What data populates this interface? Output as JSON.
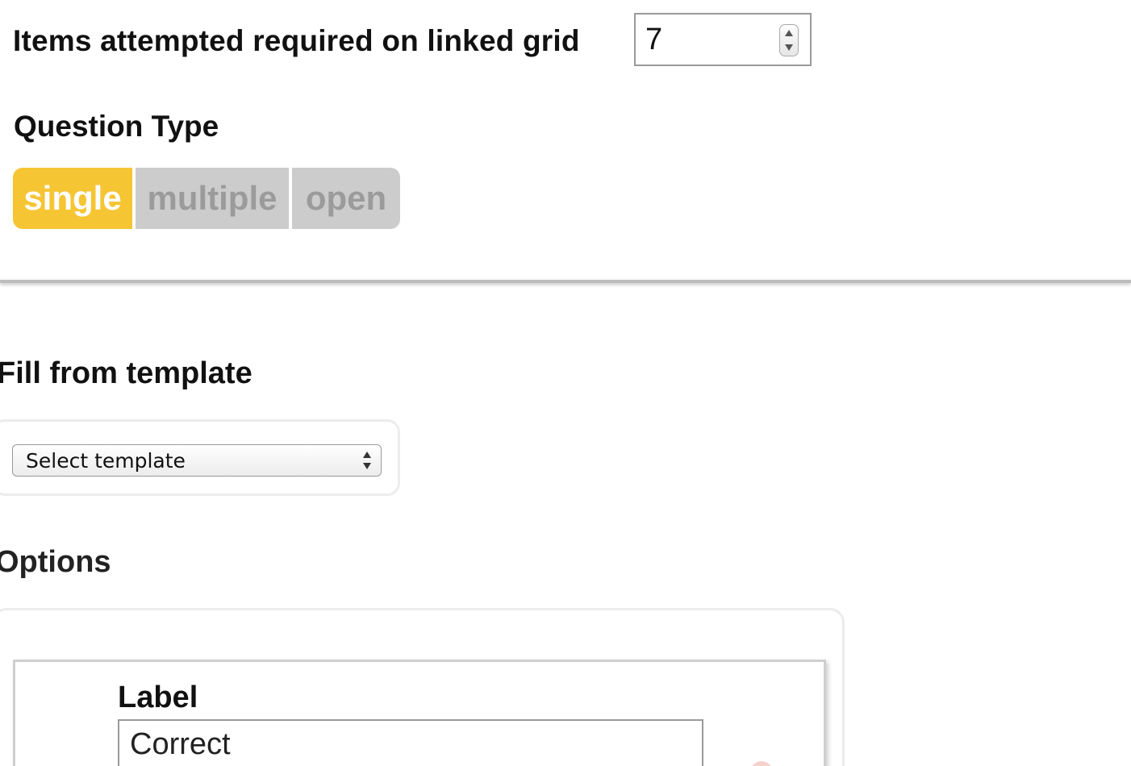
{
  "items_attempted": {
    "label": "Items attempted required on linked grid",
    "value": "7"
  },
  "question_type": {
    "heading": "Question Type",
    "options": [
      "single",
      "multiple",
      "open"
    ],
    "selected": "single",
    "selected_color": "#f5c534",
    "unselected_color": "#cccccc"
  },
  "fill_template": {
    "heading": "Fill from template",
    "select_value": "Select template"
  },
  "options": {
    "heading": "Options",
    "items": [
      {
        "field_label": "Label",
        "value": "Correct"
      }
    ]
  }
}
